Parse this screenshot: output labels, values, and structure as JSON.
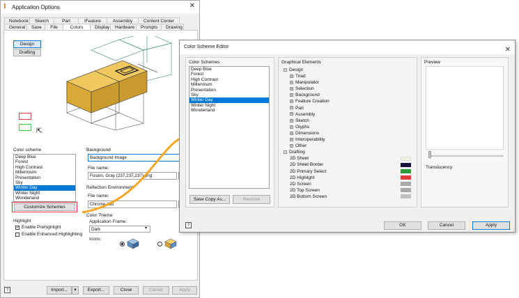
{
  "app_options": {
    "title": "Application Options",
    "tabs_row1": [
      "Notebook",
      "Sketch",
      "Part",
      "iFeature",
      "Assembly",
      "Content Center"
    ],
    "tabs_row2": [
      "General",
      "Save",
      "File",
      "Colors",
      "Display",
      "Hardware",
      "Prompts",
      "Drawing"
    ],
    "active_tab": "Colors",
    "mode_buttons": [
      "Design",
      "Drafting"
    ],
    "color_scheme_label": "Color scheme",
    "schemes": [
      "Deep Blue",
      "Forest",
      "High Contrast",
      "Millennium",
      "Presentation",
      "Sky",
      "Winter Day",
      "Winter Night",
      "Wonderland"
    ],
    "selected_scheme": "Winter Day",
    "customize_button": "Customize Schemes",
    "background_label": "Background",
    "background_value": "Background Image",
    "file_name_label": "File name:",
    "background_file": "Fusion, Gray (237,237,237).png",
    "reflection_label": "Reflection Environment",
    "reflection_file_label": "File name:",
    "reflection_file": "Chrome.dds",
    "color_theme_label": "Color Theme",
    "app_frame_label": "Application Frame:",
    "app_frame_value": "Dark",
    "icons_label": "Icons:",
    "highlight_label": "Highlight",
    "enable_prehighlight": "Enable Prehighlight",
    "enable_enhanced": "Enable Enhanced Highlighting",
    "import_button": "Import...",
    "export_button": "Export...",
    "close_button": "Close",
    "cancel_button": "Cancel",
    "apply_button": "Apply",
    "preview_colors": {
      "face": "#e0b446",
      "highlight_red": "#e53a3a",
      "highlight_green": "#39d439"
    }
  },
  "editor": {
    "title": "Color Scheme Editor",
    "schemes_label": "Color Schemes",
    "schemes": [
      "Deep Blue",
      "Forest",
      "High Contrast",
      "Millennium",
      "Presentation",
      "Sky",
      "Winter Day",
      "Winter Night",
      "Wonderland"
    ],
    "selected_scheme": "Winter Day",
    "save_copy_button": "Save Copy As...",
    "remove_button": "Remove",
    "graphical_label": "Graphical Elements",
    "design_root": "Design",
    "design_items": [
      "Triad",
      "Manipulator",
      "Selection",
      "Background",
      "Feature Creation",
      "Part",
      "Assembly",
      "Sketch",
      "Glyphs",
      "Dimensions",
      "Interoperability",
      "Other"
    ],
    "drafting_root": "Drafting",
    "drafting_items": [
      {
        "label": "2D Sheet",
        "color": "#f2f0e0"
      },
      {
        "label": "2D Sheet Border",
        "color": "#14143c"
      },
      {
        "label": "2D Primary Select",
        "color": "#2e9c3a"
      },
      {
        "label": "2D Highlight",
        "color": "#e03a3a"
      },
      {
        "label": "2D Screen",
        "color": "#a8a8a8"
      },
      {
        "label": "2D Top Screen",
        "color": "#a8a8a8"
      },
      {
        "label": "2D Bottom Screen",
        "color": "#c0c0c0"
      }
    ],
    "preview_label": "Preview",
    "translucency_label": "Translucency",
    "ok_button": "OK",
    "cancel_button": "Cancel",
    "apply_button": "Apply"
  },
  "connector_color": "#f5a623"
}
